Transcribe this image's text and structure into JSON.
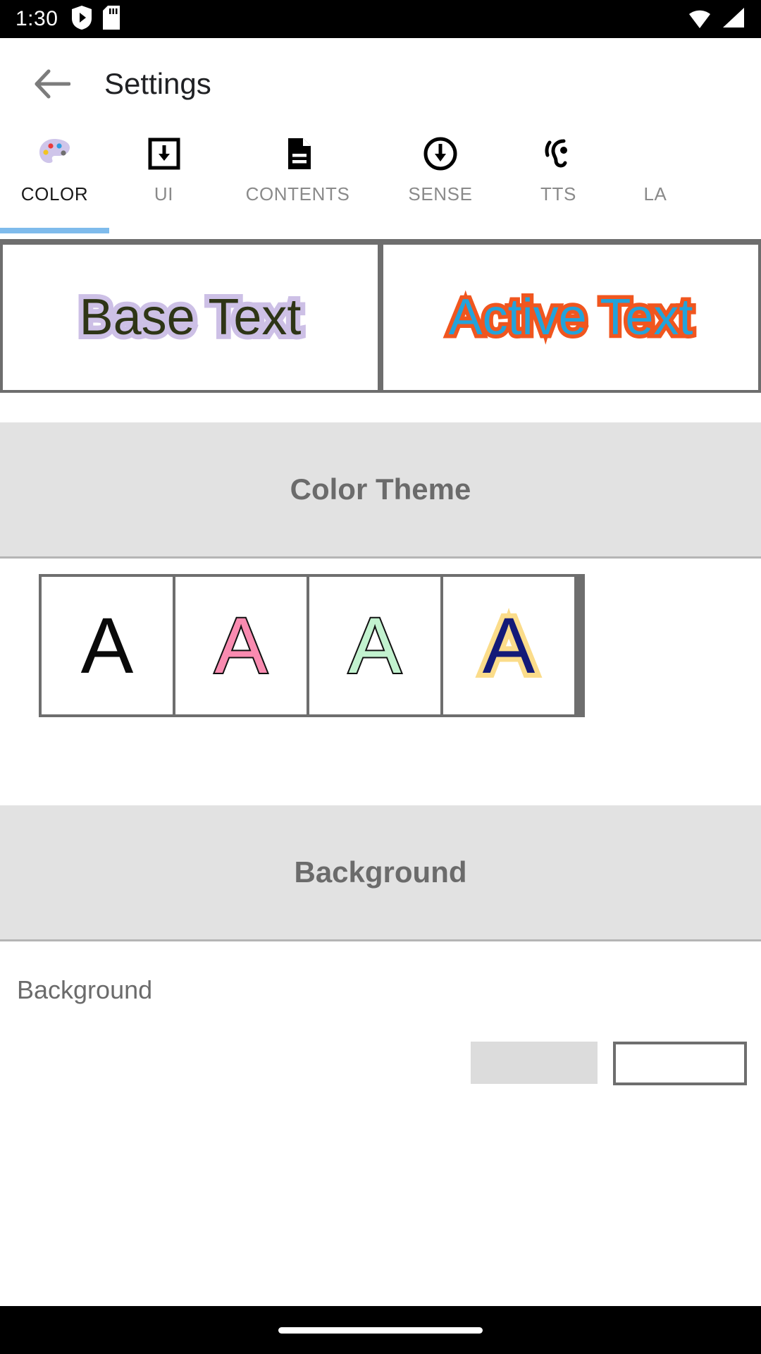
{
  "status_bar": {
    "time": "1:30",
    "left_icons": [
      "shield-play-icon",
      "sd-card-icon"
    ],
    "right_icons": [
      "wifi-icon",
      "cell-signal-icon"
    ]
  },
  "app_bar": {
    "back_label": "back-arrow",
    "title": "Settings"
  },
  "tabs": {
    "active_index": 0,
    "indicator_color": "#7fbbec",
    "items": [
      {
        "label": "COLOR",
        "icon": "palette-icon"
      },
      {
        "label": "UI",
        "icon": "boxed-download-arrow-icon"
      },
      {
        "label": "CONTENTS",
        "icon": "document-icon"
      },
      {
        "label": "SENSE",
        "icon": "circled-download-arrow-icon"
      },
      {
        "label": "TTS",
        "icon": "hearing-ear-icon"
      },
      {
        "label": "LA",
        "icon": "language-icon"
      }
    ]
  },
  "preview": {
    "base": {
      "text": "Base Text",
      "fill_color": "#2e3516",
      "outline_color": "#cdc0e6"
    },
    "active": {
      "text": "Active Text",
      "fill_color": "#23a3db",
      "outline_color": "#f0561f"
    }
  },
  "color_theme_section": {
    "header": "Color Theme",
    "swatches": [
      {
        "letter": "A",
        "fill": "#0a0a0a",
        "outline": "none"
      },
      {
        "letter": "A",
        "fill": "#f98bb0",
        "outline": "#111111"
      },
      {
        "letter": "A",
        "fill": "#c2f2cf",
        "outline": "#111111"
      },
      {
        "letter": "A",
        "fill": "#131a78",
        "outline": "#fbdc8a"
      }
    ]
  },
  "background_section": {
    "header": "Background",
    "row_label": "Background"
  }
}
